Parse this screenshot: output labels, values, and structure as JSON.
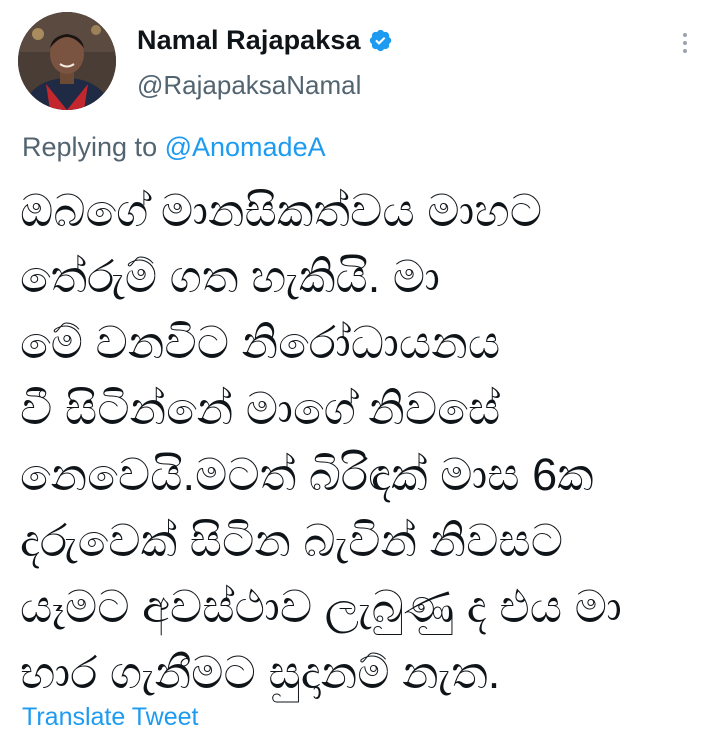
{
  "author": {
    "display_name": "Namal Rajapaksa",
    "handle": "@RajapaksaNamal",
    "verified": true,
    "avatar": "profile-photo"
  },
  "reply": {
    "prefix": "Replying to ",
    "mention": "@AnomadeA"
  },
  "tweet_lines": [
    "ඔබගේ මානසිකත්වය  මාහට",
    "තේරුම් ගත හැකියි. මා",
    "මේ වනවිට නිරෝධායනය",
    "වී සිටින්නේ මාගේ නිවසේ",
    "නෙවෙයි.මටත් බිරිඳක් මාස 6ක",
    "දරුවෙක් සිටින බැවින් නිවසට",
    "යෑමට අවස්ථාව ලැබුණු ද එය මා",
    "භාර ගැනීමට සුදානම් නැත."
  ],
  "translate_label": "Translate Tweet",
  "icons": {
    "verified": "verified-badge-icon",
    "more": "more-options-icon"
  },
  "colors": {
    "text": "#0f1419",
    "secondary": "#536471",
    "accent": "#1d9bf0"
  }
}
